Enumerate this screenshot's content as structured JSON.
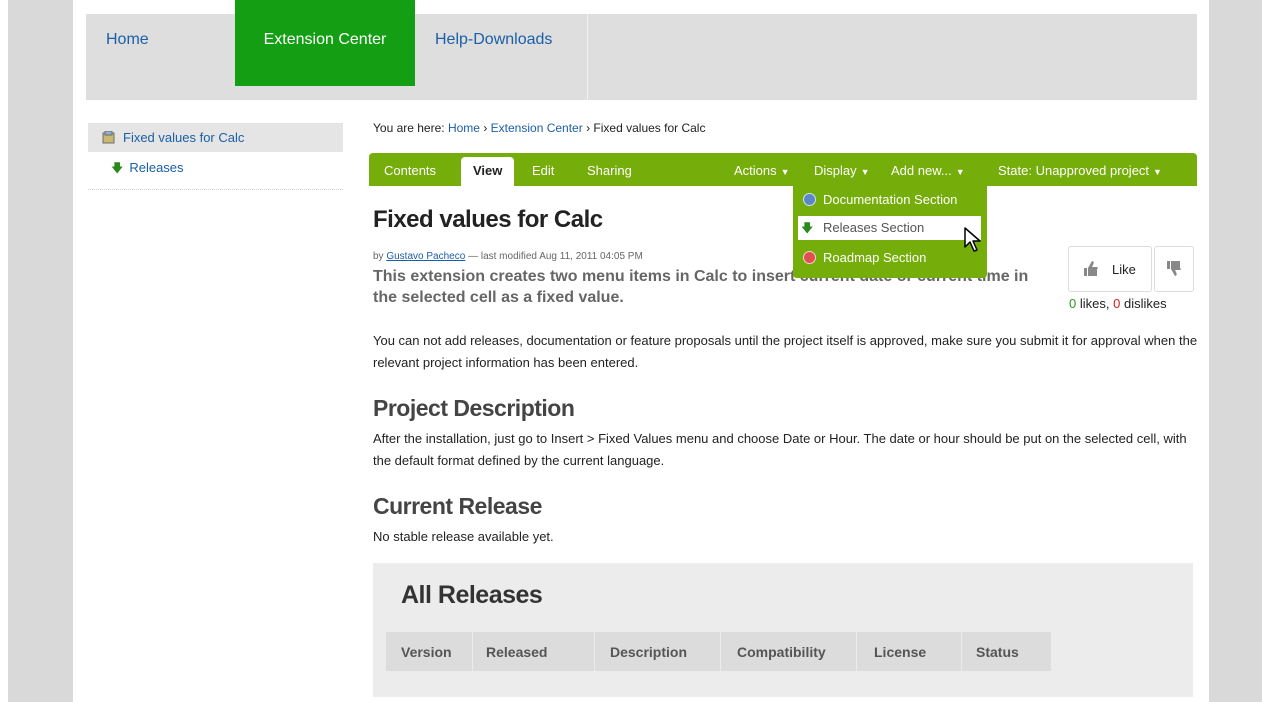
{
  "nav": {
    "home": "Home",
    "extension_center": "Extension Center",
    "help_downloads": "Help-Downloads"
  },
  "sidebar": {
    "title": "Fixed values for Calc",
    "item": "Releases"
  },
  "breadcrumb": {
    "prefix": "You are here:",
    "home": "Home",
    "sep1": "›",
    "extension_center": "Extension Center",
    "sep2": "›",
    "current": "Fixed values for Calc"
  },
  "toolbar": {
    "contents": "Contents",
    "view": "View",
    "edit": "Edit",
    "sharing": "Sharing",
    "actions": "Actions",
    "display": "Display",
    "add_new": "Add new...",
    "state": "State: Unapproved project",
    "caret": "▼"
  },
  "dropdown": {
    "doc": "Documentation Section",
    "releases": "Releases Section",
    "roadmap": "Roadmap Section"
  },
  "content": {
    "title": "Fixed values for Calc",
    "by": "by",
    "author": "Gustavo Pacheco",
    "modified": "— last modified Aug 11, 2011 04:05 PM",
    "description": "This extension creates two menu items in Calc to insert current date or current time in the selected cell as a fixed value.",
    "notice": "You can not add releases, documentation or feature proposals until the project itself is approved, make sure you submit it for approval when the relevant project information has been entered.",
    "project_description_heading": "Project Description",
    "project_description": "After the installation, just go to Insert > Fixed Values menu and choose Date or Hour. The date or hour should be put on the selected cell, with the default format defined by the current language.",
    "current_release_heading": "Current Release",
    "current_release": "No stable release available yet."
  },
  "likes": {
    "like_label": "Like",
    "likes_count": "0",
    "likes_word": "likes,",
    "dislikes_count": "0",
    "dislikes_word": "dislikes"
  },
  "releases": {
    "heading": "All Releases",
    "columns": [
      "Version",
      "Released",
      "Description",
      "Compatibility",
      "License",
      "Status"
    ]
  },
  "colors": {
    "nav_active": "#149e14",
    "toolbar_green": "#75ad0a",
    "link": "#1a5fa8"
  }
}
